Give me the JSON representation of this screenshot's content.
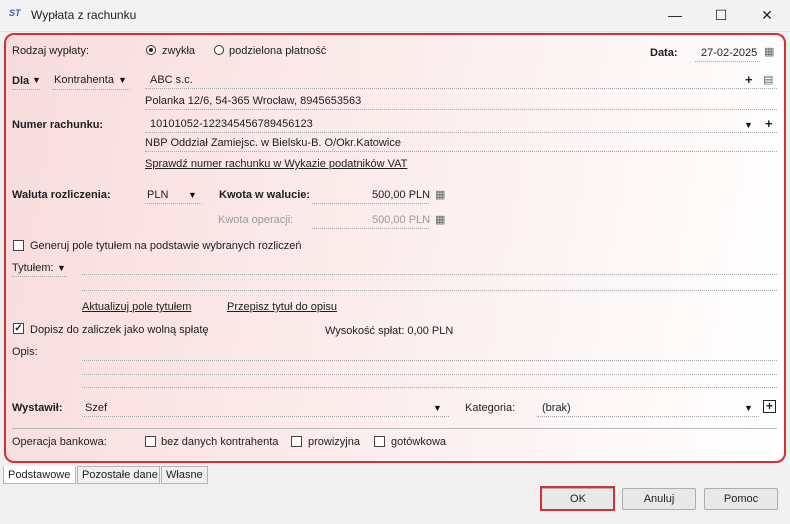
{
  "window": {
    "title": "Wypłata z rachunku",
    "icon_text": "ST",
    "minimize": "—",
    "maximize": "☐",
    "close": "✕"
  },
  "rodzaj": {
    "label": "Rodzaj wypłaty:",
    "options": [
      "zwykła",
      "podzielona płatność"
    ],
    "selected": "zwykła"
  },
  "data": {
    "label": "Data:",
    "value": "27-02-2025"
  },
  "dla": {
    "label": "Dla",
    "type": "Kontrahenta",
    "name": "ABC s.c.",
    "address": "Polanka  12/6, 54-365 Wrocław, 8945653563"
  },
  "rachunek": {
    "label": "Numer rachunku:",
    "value": "10101052-122345456789456123",
    "bank": "NBP Oddział Zamiejsc. w Bielsku-B.  O/Okr.Katowice",
    "check_link": "Sprawdź numer rachunku w Wykazie podatników VAT"
  },
  "waluta": {
    "label": "Waluta rozliczenia:",
    "value": "PLN"
  },
  "kwota": {
    "label": "Kwota w walucie:",
    "value": "500,00 PLN",
    "op_label": "Kwota operacji:",
    "op_value": "500,00 PLN"
  },
  "generuj": {
    "label": "Generuj pole tytułem na podstawie wybranych rozliczeń",
    "checked": false
  },
  "tytul": {
    "label": "Tytułem:",
    "update_link": "Aktualizuj pole tytułem",
    "copy_link": "Przepisz tytuł do opisu"
  },
  "zaliczki": {
    "label": "Dopisz do zaliczek jako wolną spłatę",
    "checked": true,
    "splat": "Wysokość spłat: 0,00 PLN"
  },
  "opis": {
    "label": "Opis:"
  },
  "wystawil": {
    "label": "Wystawił:",
    "value": "Szef",
    "kat_label": "Kategoria:",
    "kat_value": "(brak)"
  },
  "bank_op": {
    "label": "Operacja bankowa:",
    "options": [
      "bez danych kontrahenta",
      "prowizyjna",
      "gotówkowa"
    ]
  },
  "tabs": [
    "Podstawowe",
    "Pozostałe dane",
    "Własne"
  ],
  "buttons": {
    "ok": "OK",
    "cancel": "Anuluj",
    "help": "Pomoc"
  },
  "colors": {
    "highlight": "#d62f35"
  }
}
